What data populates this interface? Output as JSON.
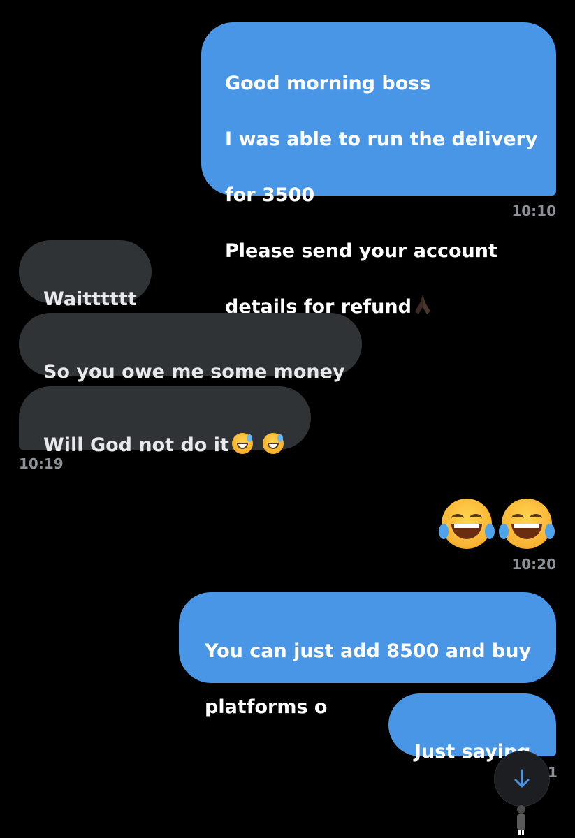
{
  "messages": {
    "m1": {
      "lines": [
        "Good morning boss",
        "I was able to run the delivery",
        "for 3500",
        "Please send your account",
        "details for refund"
      ],
      "emoji": "folded-hands"
    },
    "t1": "10:10",
    "m2": "Waitttttt",
    "m3": "So you owe me some money",
    "m4": {
      "text": "Will God not do it",
      "emoji": "grinning-sweat x2"
    },
    "t2": "10:19",
    "m_emoji": "face-with-tears-of-joy x2",
    "t3": "10:20",
    "m5": {
      "lines": [
        "You can just add 8500 and buy",
        "platforms o"
      ]
    },
    "m6": "Just saying",
    "t4": "1"
  },
  "colors": {
    "sent_bubble": "#4a96e6",
    "received_bubble": "#2f3336",
    "background": "#000000",
    "timestamp": "#8b9197"
  },
  "icons": {
    "scroll_down": "arrow-down-icon"
  }
}
